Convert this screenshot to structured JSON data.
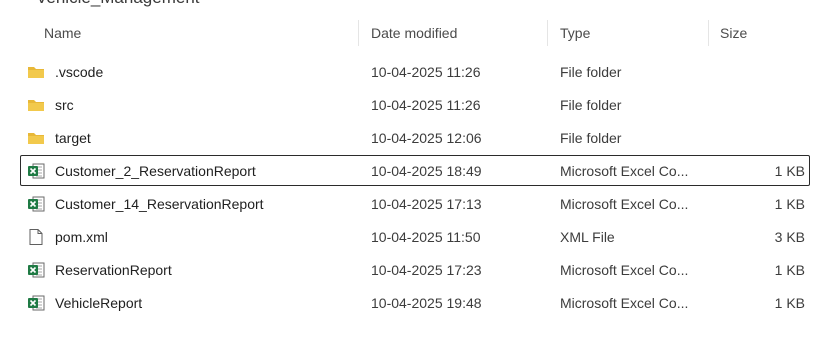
{
  "header": {
    "clipped_title": "Vehicle_Management",
    "name": "Name",
    "date_modified": "Date modified",
    "type": "Type",
    "size": "Size"
  },
  "colors": {
    "folder": "#F2C94C",
    "excel": "#1F7A44",
    "selection_border": "#2b2b2b"
  },
  "files": [
    {
      "name": ".vscode",
      "date": "10-04-2025 11:26",
      "type": "File folder",
      "size": "",
      "icon": "folder-icon",
      "selected": false
    },
    {
      "name": "src",
      "date": "10-04-2025 11:26",
      "type": "File folder",
      "size": "",
      "icon": "folder-icon",
      "selected": false
    },
    {
      "name": "target",
      "date": "10-04-2025 12:06",
      "type": "File folder",
      "size": "",
      "icon": "folder-icon",
      "selected": false
    },
    {
      "name": "Customer_2_ReservationReport",
      "date": "10-04-2025 18:49",
      "type": "Microsoft Excel Co...",
      "size": "1 KB",
      "icon": "excel-icon",
      "selected": true
    },
    {
      "name": "Customer_14_ReservationReport",
      "date": "10-04-2025 17:13",
      "type": "Microsoft Excel Co...",
      "size": "1 KB",
      "icon": "excel-icon",
      "selected": false
    },
    {
      "name": "pom.xml",
      "date": "10-04-2025 11:50",
      "type": "XML File",
      "size": "3 KB",
      "icon": "file-icon",
      "selected": false
    },
    {
      "name": "ReservationReport",
      "date": "10-04-2025 17:23",
      "type": "Microsoft Excel Co...",
      "size": "1 KB",
      "icon": "excel-icon",
      "selected": false
    },
    {
      "name": "VehicleReport",
      "date": "10-04-2025 19:48",
      "type": "Microsoft Excel Co...",
      "size": "1 KB",
      "icon": "excel-icon",
      "selected": false
    }
  ]
}
